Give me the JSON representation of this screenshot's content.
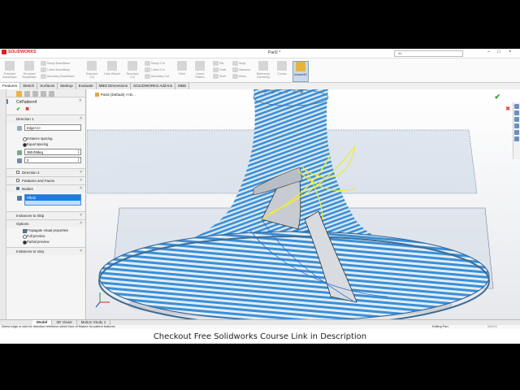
{
  "app": {
    "brand": "SOLIDWORKS",
    "doc_title": "Part2 *",
    "search_placeholder": "rib"
  },
  "commands": {
    "left_col1": [
      "Swept Boss/Base",
      "Lofted Boss/Base",
      "Boundary Boss/Base"
    ],
    "extruded": "Extruded Boss/Base",
    "revolved": "Revolved Boss/Base",
    "extruded_cut": "Extruded Cut",
    "hole_wizard": "Hole Wizard",
    "revolved_cut": "Revolved Cut",
    "cut_col": [
      "Swept Cut",
      "Lofted Cut",
      "Boundary Cut"
    ],
    "fillet": "Fillet",
    "linear_pattern": "Linear Pattern",
    "rib_col": [
      "Rib",
      "Draft",
      "Shell"
    ],
    "wrap_col": [
      "Wrap",
      "Intersect",
      "Mirror"
    ],
    "reference": "Reference Geometry",
    "curves": "Curves",
    "instant3d": "Instant3D"
  },
  "tabs": [
    "Features",
    "Sketch",
    "Surfaces",
    "Markup",
    "Evaluate",
    "MBD Dimensions",
    "SOLIDWORKS Add-Ins",
    "MBD"
  ],
  "pm": {
    "title": "CirPattern4",
    "direction1": "Direction 1",
    "edge_value": "Edge<1>",
    "instance_spacing": "Instance spacing",
    "equal_spacing": "Equal spacing",
    "angle_value": "360.00deg",
    "count_value": "2",
    "direction2": "Direction 2",
    "features_faces": "Features and Faces",
    "bodies": "Bodies",
    "body_item": "Fillet2",
    "instances_skip": "Instances to Skip",
    "options": "Options",
    "propagate": "Propagate visual properties",
    "full_preview": "Full preview",
    "partial_preview": "Partial preview",
    "instances_vary": "Instances to Vary"
  },
  "viewport": {
    "tree_label": "Part2 (Default) <<D..."
  },
  "model_tabs": [
    "Model",
    "3D Views",
    "Motion Study 1"
  ],
  "status": {
    "message": "Select edge or axis for direction reference select face of feature for pattern features",
    "mode": "Editing Part",
    "units": "MMGS"
  },
  "caption": "Checkout Free Solidworks Course Link in Description",
  "colors": {
    "stripe_blue": "#3a8fd8",
    "stripe_light": "#dbe8f0",
    "accent_yellow": "#ecec3a",
    "selection_blue": "#1e7ce0"
  }
}
